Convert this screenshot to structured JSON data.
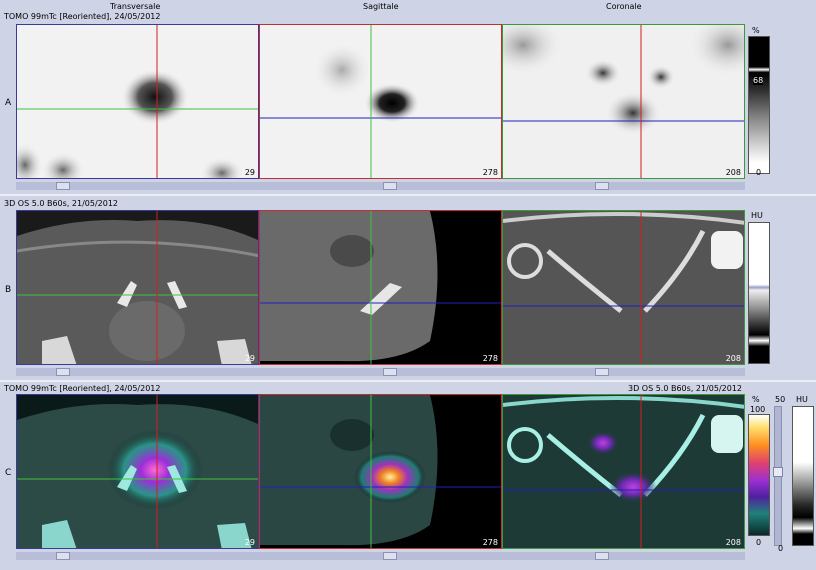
{
  "columns": {
    "transversal": "Transversale",
    "sagittal": "Sagittale",
    "coronal": "Coronale"
  },
  "rows": {
    "a": {
      "letter": "A",
      "title": "TOMO 99mTc [Reoriented], 24/05/2012",
      "unit": "%",
      "top_value": "68",
      "bottom_value": "0"
    },
    "b": {
      "letter": "B",
      "title": "3D OS 5.0 B60s, 21/05/2012",
      "unit": "HU"
    },
    "c": {
      "letter": "C",
      "title_left": "TOMO 99mTc [Reoriented], 24/05/2012",
      "title_right": "3D OS 5.0 B60s, 21/05/2012",
      "unit_left": "%",
      "top_left": "100",
      "bottom_left": "0",
      "slider_value": "50",
      "unit_right": "HU",
      "bottom_right": "0"
    }
  },
  "slices": {
    "transversal": "29",
    "sagittal": "278",
    "coronal": "208"
  },
  "colors": {
    "frame_transversal": "#3a3a9a",
    "frame_sagittal": "#c03030",
    "frame_coronal": "#3a9a3a",
    "crosshair_red": "#d02020",
    "crosshair_green": "#40c040",
    "crosshair_blue": "#2020c0"
  }
}
